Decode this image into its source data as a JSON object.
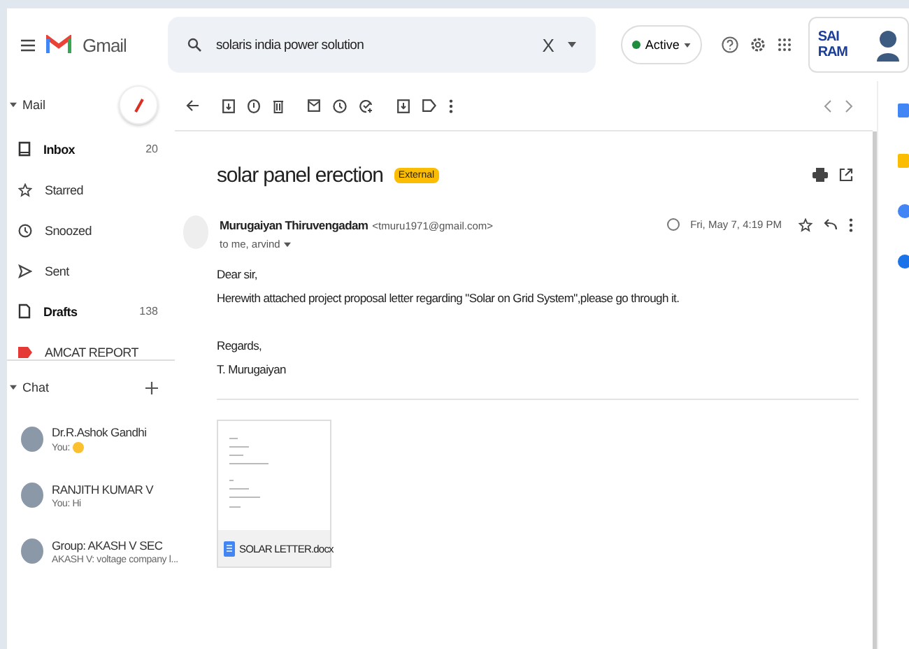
{
  "header": {
    "app_name": "Gmail",
    "search": {
      "value": "solaris india power solution",
      "clear": "X"
    },
    "status": {
      "label": "Active",
      "on": true
    },
    "org_logo": "SAI RAM"
  },
  "sidebar": {
    "mail_label": "Mail",
    "folders": [
      {
        "label": "Inbox",
        "count": "20",
        "bold": true,
        "kind": "inbox"
      },
      {
        "label": "Starred",
        "bold": false,
        "kind": "star"
      },
      {
        "label": "Snoozed",
        "bold": false,
        "kind": "clock"
      },
      {
        "label": "Sent",
        "bold": false,
        "kind": "send"
      },
      {
        "label": "Drafts",
        "count": "138",
        "bold": true,
        "kind": "file"
      },
      {
        "label": "AMCAT REPORT",
        "bold": false,
        "kind": "label",
        "color": "#e53935"
      }
    ],
    "chat_label": "Chat",
    "contacts": [
      {
        "name": "Dr.R.Ashok Gandhi",
        "preview": "You:",
        "sticker": true
      },
      {
        "name": "RANJITH KUMAR V",
        "preview": "You: Hi",
        "sticker": false
      },
      {
        "name": "Group: AKASH V SEC",
        "preview": "AKASH V: voltage company l...",
        "sticker": false
      }
    ]
  },
  "message": {
    "subject": "solar panel erection",
    "badge": "External",
    "sender": "Murugaiyan Thiruvengadam",
    "email": "<tmuru1971@gmail.com>",
    "date": "Fri, May 7, 4:19 PM",
    "recipients": "to me, arvind",
    "body": [
      [
        "Dear sir,",
        "Herewith attached project proposal letter regarding \"Solar on Grid System\",please go through it."
      ],
      [
        "Regards,",
        "T. Murugaiyan"
      ]
    ],
    "attachment": "SOLAR LETTER.docx"
  }
}
